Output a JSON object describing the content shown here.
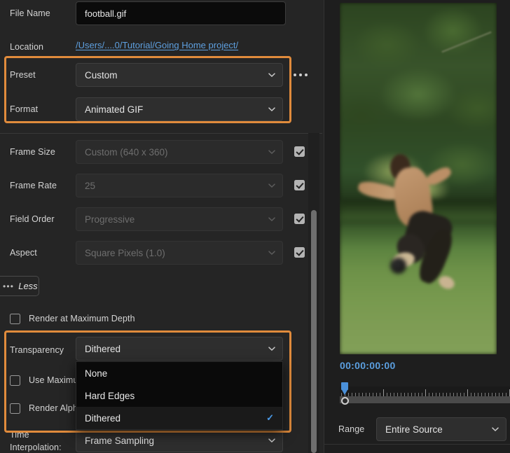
{
  "panel": {
    "file_name": {
      "label": "File Name",
      "value": "football.gif"
    },
    "location": {
      "label": "Location",
      "value": "/Users/....0/Tutorial/Going Home project/"
    },
    "preset": {
      "label": "Preset",
      "value": "Custom"
    },
    "format": {
      "label": "Format",
      "value": "Animated GIF"
    },
    "more_options_icon": "ellipsis-icon",
    "frame_size": {
      "label": "Frame Size",
      "value": "Custom (640 x 360)",
      "checked": true,
      "disabled": true
    },
    "frame_rate": {
      "label": "Frame Rate",
      "value": "25",
      "checked": true,
      "disabled": true
    },
    "field_order": {
      "label": "Field Order",
      "value": "Progressive",
      "checked": true,
      "disabled": true
    },
    "aspect": {
      "label": "Aspect",
      "value": "Square Pixels (1.0)",
      "checked": true,
      "disabled": true
    },
    "less_button": {
      "label": "Less",
      "dots": "•••"
    },
    "render_max_depth": {
      "label": "Render at Maximum Depth",
      "checked": false
    },
    "transparency": {
      "label": "Transparency",
      "value": "Dithered"
    },
    "use_maximum": {
      "label": "Use Maximum",
      "checked": false
    },
    "render_alpha": {
      "label": "Render Alpha",
      "checked": false
    },
    "time_interpolation": {
      "label_line1": "Time",
      "label_line2": "Interpolation:",
      "value": "Frame Sampling"
    }
  },
  "transparency_dropdown": {
    "open": true,
    "options": [
      {
        "label": "None",
        "selected": false
      },
      {
        "label": "Hard Edges",
        "selected": false
      },
      {
        "label": "Dithered",
        "selected": true
      }
    ],
    "check_glyph": "✓"
  },
  "preview": {
    "timecode": "00:00:00:00",
    "range": {
      "label": "Range",
      "value": "Entire Source"
    }
  },
  "colors": {
    "highlight": "#e08b3c",
    "link": "#5ea0e0",
    "timecode": "#5b9fe0",
    "accent_check": "#4a9bea",
    "panel_bg": "#252525",
    "field_bg": "#2e2e2e",
    "popup_bg": "#0a0a0a"
  }
}
